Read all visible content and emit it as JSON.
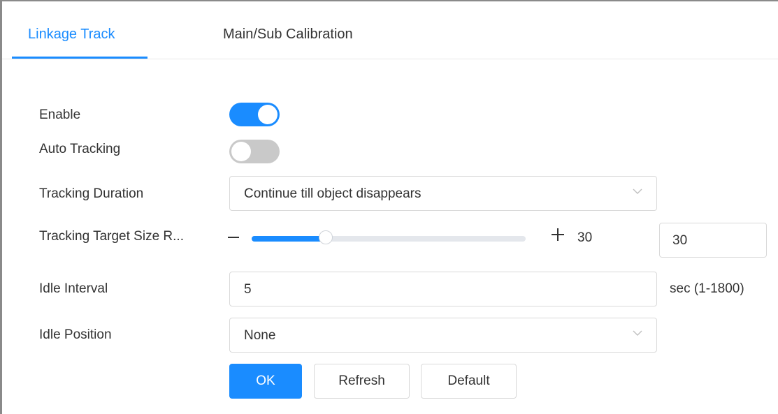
{
  "tabs": [
    {
      "label": "Linkage Track",
      "active": true
    },
    {
      "label": "Main/Sub Calibration",
      "active": false
    }
  ],
  "form": {
    "enable": {
      "label": "Enable",
      "on": true
    },
    "auto_tracking": {
      "label": "Auto Tracking",
      "on": false
    },
    "tracking_duration": {
      "label": "Tracking Duration",
      "value": "Continue till object disappears",
      "icon": "chevron-down-icon"
    },
    "target_size": {
      "label": "Tracking Target Size R...",
      "value": 30,
      "value_text": "30",
      "input_value": "30",
      "fill_fraction": 0.27
    },
    "idle_interval": {
      "label": "Idle Interval",
      "value": "5",
      "suffix": "sec (1-1800)"
    },
    "idle_position": {
      "label": "Idle Position",
      "value": "None",
      "icon": "chevron-down-icon"
    }
  },
  "buttons": {
    "ok": "OK",
    "refresh": "Refresh",
    "default": "Default"
  },
  "colors": {
    "accent": "#1a8cff",
    "toggle_off": "#c9c9c9",
    "track": "#e4e7ec"
  }
}
